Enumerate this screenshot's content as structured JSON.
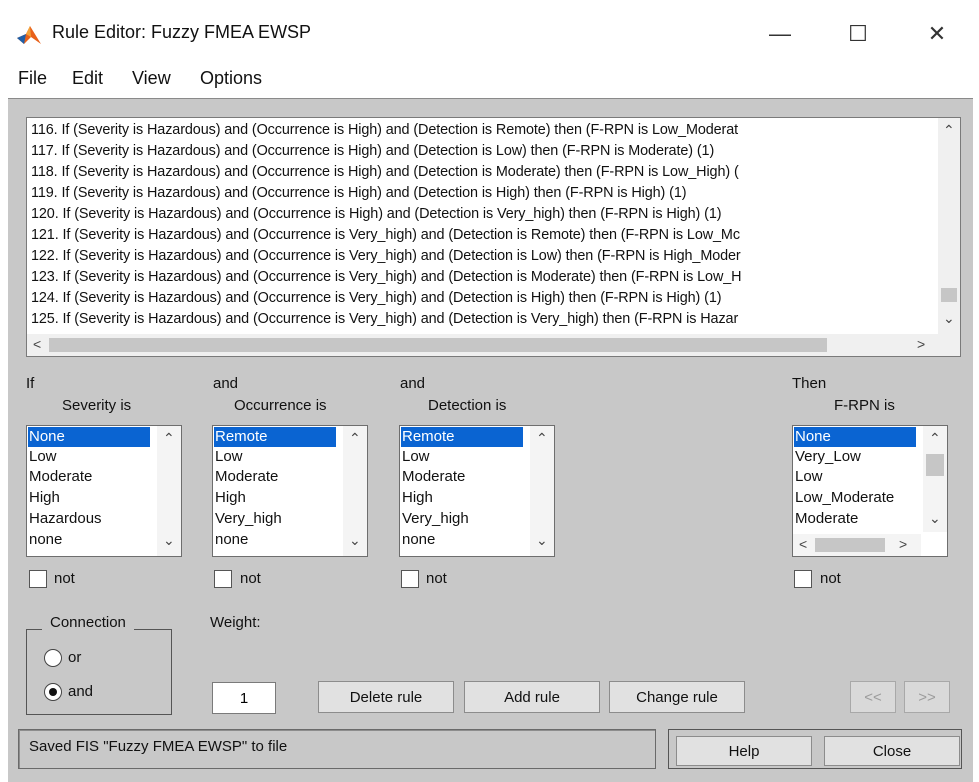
{
  "window": {
    "title": "Rule Editor: Fuzzy FMEA EWSP",
    "controls": {
      "minimize": "—",
      "maximize": "☐",
      "close": "✕"
    }
  },
  "menu": [
    "File",
    "Edit",
    "View",
    "Options"
  ],
  "rules": [
    "116. If (Severity is Hazardous) and (Occurrence is High) and (Detection is Remote) then (F-RPN is Low_Moderat",
    "117. If (Severity is Hazardous) and (Occurrence is High) and (Detection is Low) then (F-RPN is Moderate) (1)",
    "118. If (Severity is Hazardous) and (Occurrence is High) and (Detection is Moderate) then (F-RPN is Low_High) (",
    "119. If (Severity is Hazardous) and (Occurrence is High) and (Detection is High) then (F-RPN is High) (1)",
    "120. If (Severity is Hazardous) and (Occurrence is High) and (Detection is Very_high) then (F-RPN is High) (1)",
    "121. If (Severity is Hazardous) and (Occurrence is Very_high) and (Detection is Remote) then (F-RPN is Low_Mc",
    "122. If (Severity is Hazardous) and (Occurrence is Very_high) and (Detection is Low) then (F-RPN is High_Moder",
    "123. If (Severity is Hazardous) and (Occurrence is Very_high) and (Detection is Moderate) then (F-RPN is Low_H",
    "124. If (Severity is Hazardous) and (Occurrence is Very_high) and (Detection is High) then (F-RPN is High) (1)",
    "125. If (Severity is Hazardous) and (Occurrence is Very_high) and (Detection is Very_high) then (F-RPN is Hazar"
  ],
  "scroll_arrows": {
    "up": "⌃",
    "down": "⌄",
    "left": "<",
    "right": ">"
  },
  "antecedents": [
    {
      "connector": "If",
      "label": "Severity is",
      "options": [
        "None",
        "Low",
        "Moderate",
        "High",
        "Hazardous",
        "none"
      ],
      "selected": "None",
      "not_label": "not"
    },
    {
      "connector": "and",
      "label": "Occurrence is",
      "options": [
        "Remote",
        "Low",
        "Moderate",
        "High",
        "Very_high",
        "none"
      ],
      "selected": "Remote",
      "not_label": "not"
    },
    {
      "connector": "and",
      "label": "Detection is",
      "options": [
        "Remote",
        "Low",
        "Moderate",
        "High",
        "Very_high",
        "none"
      ],
      "selected": "Remote",
      "not_label": "not"
    }
  ],
  "consequent": {
    "connector": "Then",
    "label": "F-RPN is",
    "options": [
      "None",
      "Very_Low",
      "Low",
      "Low_Moderate",
      "Moderate"
    ],
    "selected": "None",
    "not_label": "not"
  },
  "connection": {
    "title": "Connection",
    "options": [
      "or",
      "and"
    ],
    "selected": "and"
  },
  "weight": {
    "label": "Weight:",
    "value": "1"
  },
  "buttons": {
    "delete": "Delete rule",
    "add": "Add rule",
    "change": "Change rule",
    "prev": "<<",
    "next": ">>",
    "help": "Help",
    "close": "Close"
  },
  "status": "Saved FIS \"Fuzzy FMEA EWSP\" to file",
  "colors": {
    "panel": "#c8c8c8",
    "selection": "#0a64d2",
    "matlab_orange": "#e8611a",
    "matlab_blue": "#1f5fa8"
  }
}
